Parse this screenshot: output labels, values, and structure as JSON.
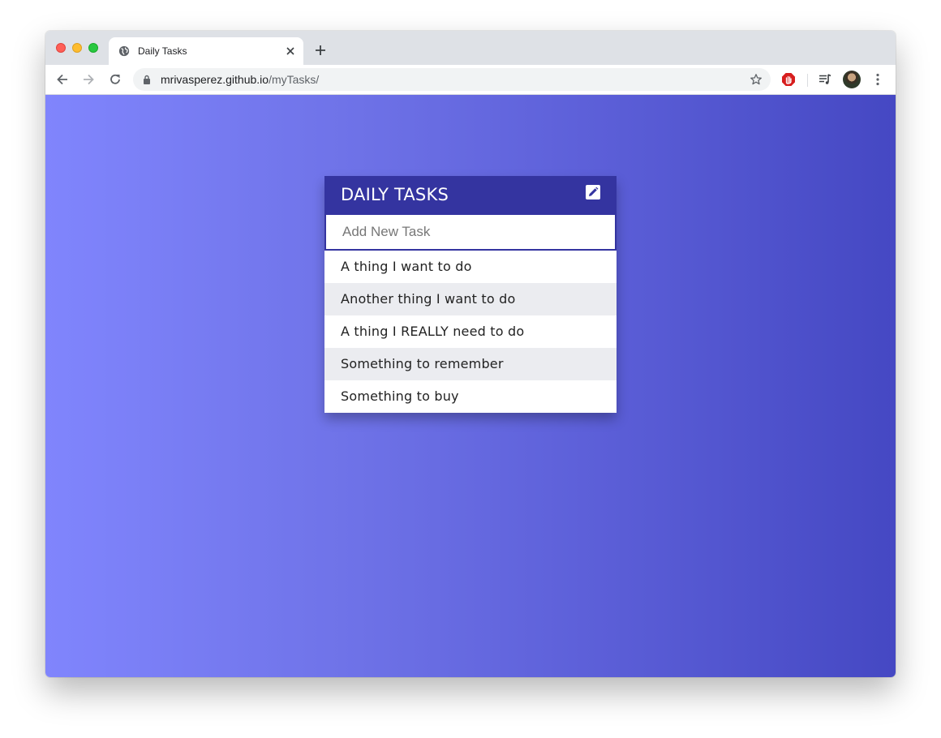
{
  "browser": {
    "tab": {
      "title": "Daily Tasks",
      "favicon": "globe-icon"
    },
    "address": {
      "domain": "mrivasperez.github.io",
      "path": "/myTasks/"
    },
    "icons": {
      "back": "arrow-left-icon",
      "forward": "arrow-right-icon",
      "reload": "reload-icon",
      "lock": "lock-icon",
      "star": "star-icon",
      "extension": "stop-hand-icon",
      "media": "media-playlist-icon",
      "menu": "kebab-menu-icon"
    }
  },
  "app": {
    "title": "DAILY TASKS",
    "input": {
      "placeholder": "Add New Task",
      "value": ""
    },
    "tasks": [
      "A thing I want to do",
      "Another thing I want to do",
      "A thing I REALLY need to do",
      "Something to remember",
      "Something to buy"
    ],
    "colors": {
      "header": "#3434a0",
      "gradient_start": "#8085fd",
      "gradient_end": "#4548c3",
      "alt_row": "#ebecf0"
    }
  }
}
